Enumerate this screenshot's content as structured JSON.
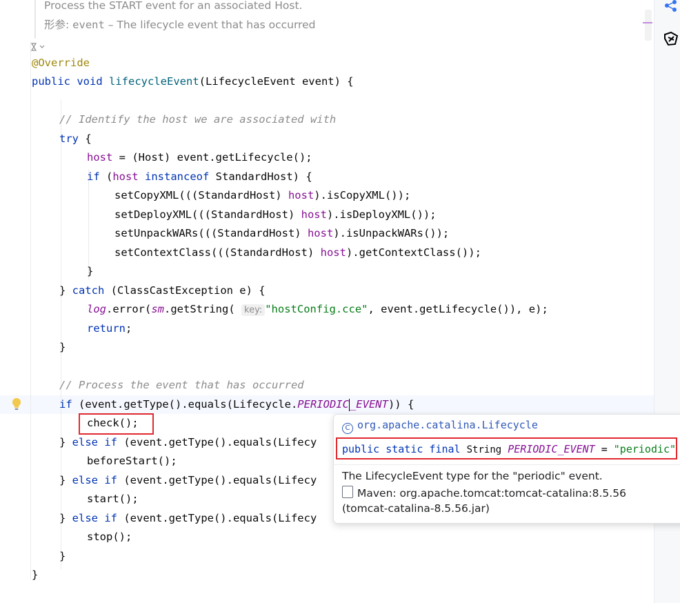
{
  "doc_comment": {
    "line1": "Process the START event for an associated Host.",
    "param_label": "形参:",
    "param_name": "event",
    "param_desc": " – The lifecycle event that has occurred"
  },
  "code": {
    "l_override": "@Override",
    "l_sig_public": "public",
    "l_sig_void": "void",
    "l_sig_name": "lifecycleEvent",
    "l_sig_rest": "(LifecycleEvent event) {",
    "l_c1": "// Identify the host we are associated with",
    "l_try": "try",
    "l_try_rest": " {",
    "l_host_var": "host",
    "l_host_rest": " = (Host) event.getLifecycle();",
    "l_if": "if",
    "l_if_p": " (",
    "l_if_host": "host",
    "l_if_inst": "instanceof",
    "l_if_rest": " StandardHost) {",
    "l_copy_a": "setCopyXML(((StandardHost) ",
    "l_copy_h": "host",
    "l_copy_b": ").isCopyXML());",
    "l_deploy_a": "setDeployXML(((StandardHost) ",
    "l_deploy_h": "host",
    "l_deploy_b": ").isDeployXML());",
    "l_unpack_a": "setUnpackWARs(((StandardHost) ",
    "l_unpack_h": "host",
    "l_unpack_b": ").isUnpackWARs());",
    "l_ctx_a": "setContextClass(((StandardHost) ",
    "l_ctx_h": "host",
    "l_ctx_b": ").getContextClass());",
    "l_brace": "}",
    "l_catch_a": "} ",
    "l_catch_kw": "catch",
    "l_catch_b": " (ClassCastException e) {",
    "l_log": "log",
    "l_log_a": ".error(",
    "l_sm": "sm",
    "l_log_b": ".getString(",
    "l_hint": "key:",
    "l_log_str": "\"hostConfig.cce\"",
    "l_log_c": ", event.getLifecycle()), e);",
    "l_return": "return",
    "l_return_b": ";",
    "l_c2": "// Process the event that has occurred",
    "l_if2_kw": "if",
    "l_if2_a": " (event.getType().equals(Lifecycle.",
    "l_if2_const1": "PERIODIC",
    "l_if2_const2": "_EVENT",
    "l_if2_b": ")) {",
    "l_check": "check();",
    "l_else_a": "} ",
    "l_else_kw": "else if",
    "l_else_b": " (event.getType().equals(Lifecy",
    "l_before": "beforeStart();",
    "l_start": "start();",
    "l_stop": "stop();",
    "l_close": "}"
  },
  "popup": {
    "package": "org.apache.catalina.Lifecycle",
    "sig_kw": "public static final",
    "sig_type": "String",
    "sig_name": "PERIODIC_EVENT",
    "sig_eq": " = ",
    "sig_val": "\"periodic\"",
    "description": "The LifecycleEvent type for the \"periodic\" event.",
    "maven": "Maven: org.apache.tomcat:tomcat-catalina:8.5.56 (tomcat-catalina-8.5.56.jar)"
  },
  "colors": {
    "highlight_box": "#e0282e",
    "keyword": "#0033b3",
    "string": "#067d17",
    "field": "#871094"
  }
}
